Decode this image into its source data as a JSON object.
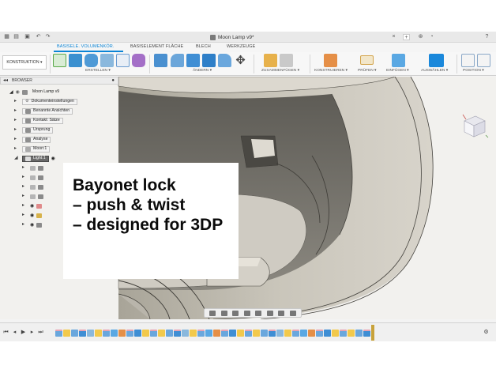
{
  "window": {
    "document_title": "Moon Lamp v9*",
    "close_symbol": "×",
    "plus_symbol": "+"
  },
  "tabs": [
    {
      "label": "BASISELE. VOLUMENKÖR.",
      "active": true
    },
    {
      "label": "BASISELEMENT FLÄCHE",
      "active": false
    },
    {
      "label": "BLECH",
      "active": false
    },
    {
      "label": "WERKZEUGE",
      "active": false
    }
  ],
  "toolbar": {
    "workspace_label": "KONSTRUKTION ▾",
    "groups": [
      "ERSTELLEN ▾",
      "ÄNDERN ▾",
      "ZUSAMMENFÜGEN ▾",
      "KONSTRUIEREN ▾",
      "PRÜFEN ▾",
      "EINFÜGEN ▾",
      "AUSWÄHLEN ▾",
      "POSITION ▾"
    ],
    "accent_color": "#0a84d6"
  },
  "browser": {
    "label": "BROWSER",
    "items": [
      {
        "label": "Moon Lamp v9",
        "icon": "component-icon"
      },
      {
        "label": "Dokumenteinstellungen",
        "icon": "gear-icon"
      },
      {
        "label": "Benannte Ansichten",
        "icon": "folder-icon"
      },
      {
        "label": "Kontakt: Sätze",
        "icon": "folder-icon"
      },
      {
        "label": "Ursprung",
        "icon": "folder-icon"
      },
      {
        "label": "Analyse",
        "icon": "folder-icon"
      },
      {
        "label": "Moon:1",
        "icon": "body-icon"
      },
      {
        "label": "Light:1",
        "icon": "body-icon"
      }
    ]
  },
  "overlay": {
    "line1": "Bayonet lock",
    "line2": "– push & twist",
    "line3": "– designed for 3DP"
  }
}
